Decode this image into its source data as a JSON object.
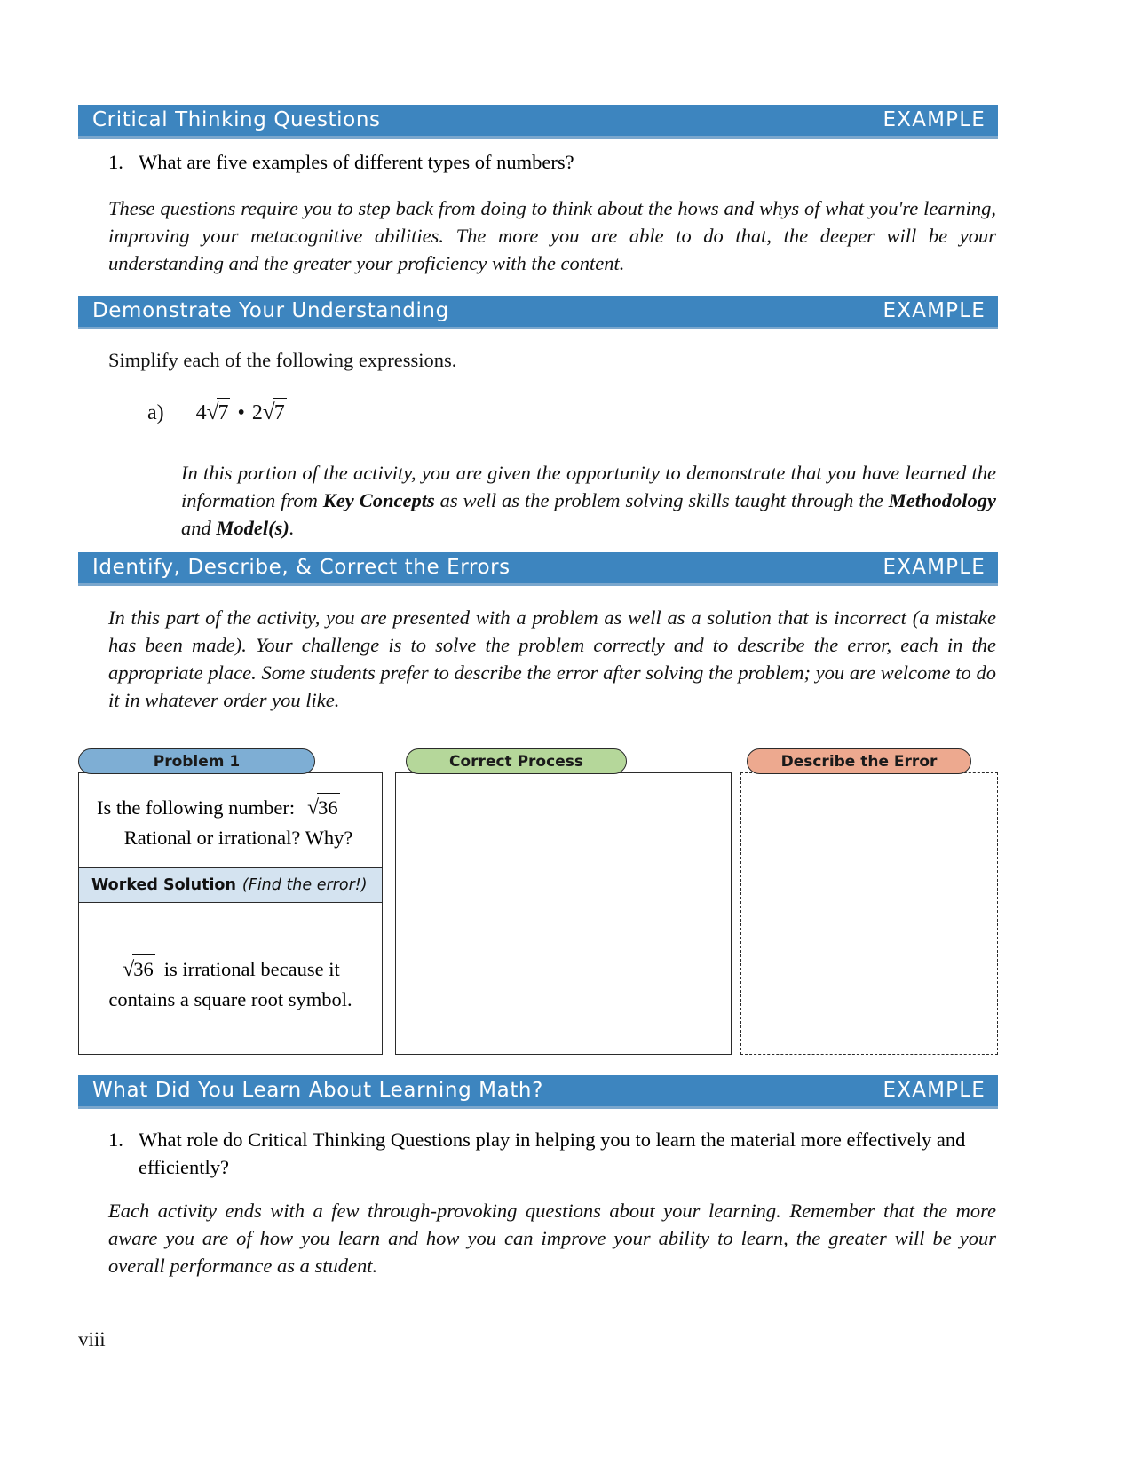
{
  "page": {
    "number": "viii",
    "accent_color": "#3d85bf",
    "accent_underline": "#7ba7cd"
  },
  "sections": [
    {
      "id": "critical-thinking-questions",
      "title": "Critical Thinking Questions",
      "badge": "EXAMPLE",
      "question_number": "1.",
      "question": "What are five examples of different types of numbers?",
      "description": "These questions require you to step back from doing to think about the hows and whys of what you're learning, improving your metacognitive abilities. The more you are able to do that, the deeper will be your understanding and the greater your proficiency with the content."
    },
    {
      "id": "demonstrate-your-understanding",
      "title": "Demonstrate Your Understanding",
      "badge": "EXAMPLE",
      "instruction": "Simplify each of the following expressions.",
      "item_label": "a)",
      "expression": {
        "coefficient_1": "4",
        "radicand_1": "7",
        "operator": "•",
        "coefficient_2": "2",
        "radicand_2": "7"
      },
      "description_parts": [
        {
          "text": "In this portion of the activity, you are given the opportunity to demonstrate that you have learned the information from ",
          "style": "italic"
        },
        {
          "text": "Key Concepts",
          "style": "bold-italic"
        },
        {
          "text": " as well as the problem solving skills taught through the ",
          "style": "italic"
        },
        {
          "text": "Methodology",
          "style": "bold-italic"
        },
        {
          "text": " and ",
          "style": "italic"
        },
        {
          "text": "Model(s)",
          "style": "bold-italic"
        },
        {
          "text": ".",
          "style": "italic"
        }
      ]
    },
    {
      "id": "identify-describe-correct-the-errors",
      "title": "Identify, Describe, & Correct the Errors",
      "badge": "EXAMPLE",
      "description": "In this part of the activity, you are presented with a problem as well as a solution that is incorrect (a mistake has been made). Your challenge is to solve the problem correctly and to describe the error, each in the appropriate place. Some students prefer to describe the error after solving the problem; you are welcome to do it in whatever order you like.",
      "columns": {
        "problem": {
          "tab_label": "Problem 1",
          "tab_color": "#7eaed4",
          "question_line_1_prefix": "Is the following number:",
          "question_radicand": "36",
          "question_line_2": "Rational or irrational? Why?",
          "worked_solution_label": "Worked Solution",
          "worked_solution_hint": "(Find the error!)",
          "worked_solution_band_color": "#d4e3f0",
          "solution_radicand": "36",
          "solution_text_line_1": "is irrational because it",
          "solution_text_line_2": "contains a square root symbol."
        },
        "correct_process": {
          "tab_label": "Correct Process",
          "tab_color": "#b5d79a",
          "content": ""
        },
        "describe_error": {
          "tab_label": "Describe the Error",
          "tab_color": "#eda98f",
          "content": "",
          "border_style": "dashed"
        }
      }
    },
    {
      "id": "what-did-you-learn-about-learning-math",
      "title": "What Did You Learn About Learning Math?",
      "badge": "EXAMPLE",
      "question_number": "1.",
      "question": "What role do Critical Thinking Questions play in helping you to learn the material more effectively and efficiently?",
      "description": "Each activity ends with a few through-provoking questions about your learning. Remember that the more aware you are of how you learn and how you can improve your ability to learn, the greater will be your overall performance as a student."
    }
  ]
}
